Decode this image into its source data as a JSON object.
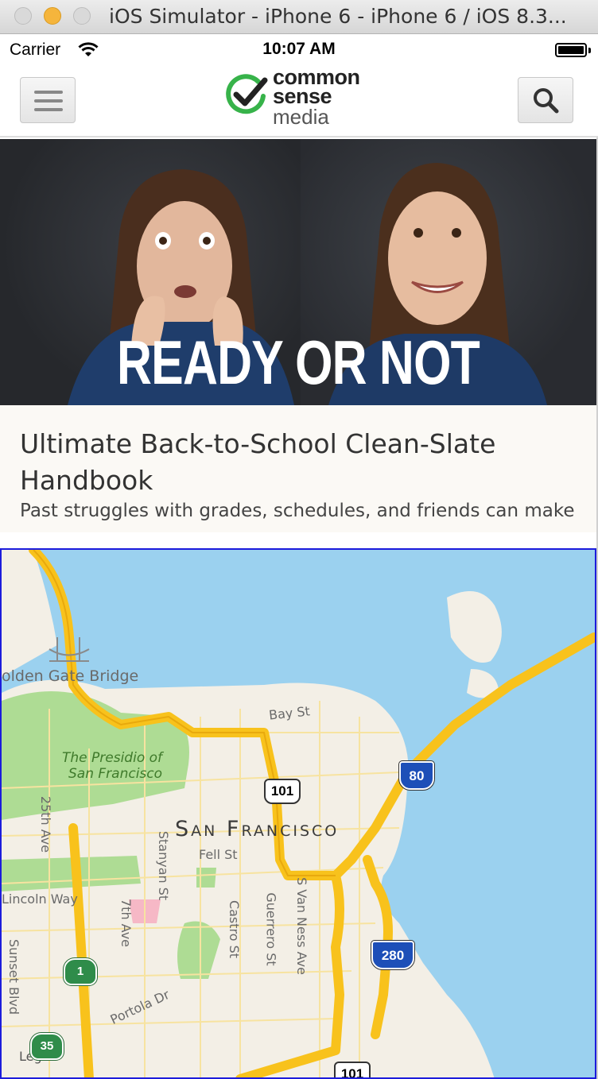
{
  "window": {
    "title": "iOS Simulator - iPhone 6 - iPhone 6 / iOS 8.3..."
  },
  "status_bar": {
    "carrier": "Carrier",
    "time": "10:07 AM",
    "wifi_icon": "wifi-icon",
    "battery_icon": "battery-icon"
  },
  "header": {
    "menu_icon": "hamburger-menu-icon",
    "search_icon": "search-icon",
    "logo": {
      "line1": "common",
      "line2": "sense",
      "line3": "media",
      "mark_color": "#37b34a"
    }
  },
  "hero": {
    "overlay_text": "READY OR NOT"
  },
  "article": {
    "title": "Ultimate Back-to-School Clean-Slate Handbook",
    "description": "Past struggles with grades, schedules, and friends can make"
  },
  "map": {
    "labels": {
      "golden_gate": "olden Gate Bridge",
      "presidio_1": "The Presidio of",
      "presidio_2": "San Francisco",
      "city": "San Francisco",
      "bay_st": "Bay St",
      "fell_st": "Fell St",
      "stanyan_st": "Stanyan St",
      "ave_25th": "25th Ave",
      "lincoln_way": "Lincoln Way",
      "ave_7th": "7th Ave",
      "castro_st": "Castro St",
      "guerrero_st": "Guerrero St",
      "van_ness_ave": "S Van Ness Ave",
      "sunset_blvd": "Sunset Blvd",
      "portola_dr": "Portola Dr",
      "legal": "Legal"
    },
    "shields": {
      "us101": "101",
      "i80": "80",
      "i280": "280",
      "ca1": "1",
      "ca35": "35",
      "us101_bottom": "101"
    },
    "colors": {
      "water": "#9bd1ef",
      "land": "#f3efe6",
      "park": "#aedc94",
      "highway": "#f8c21c"
    }
  }
}
